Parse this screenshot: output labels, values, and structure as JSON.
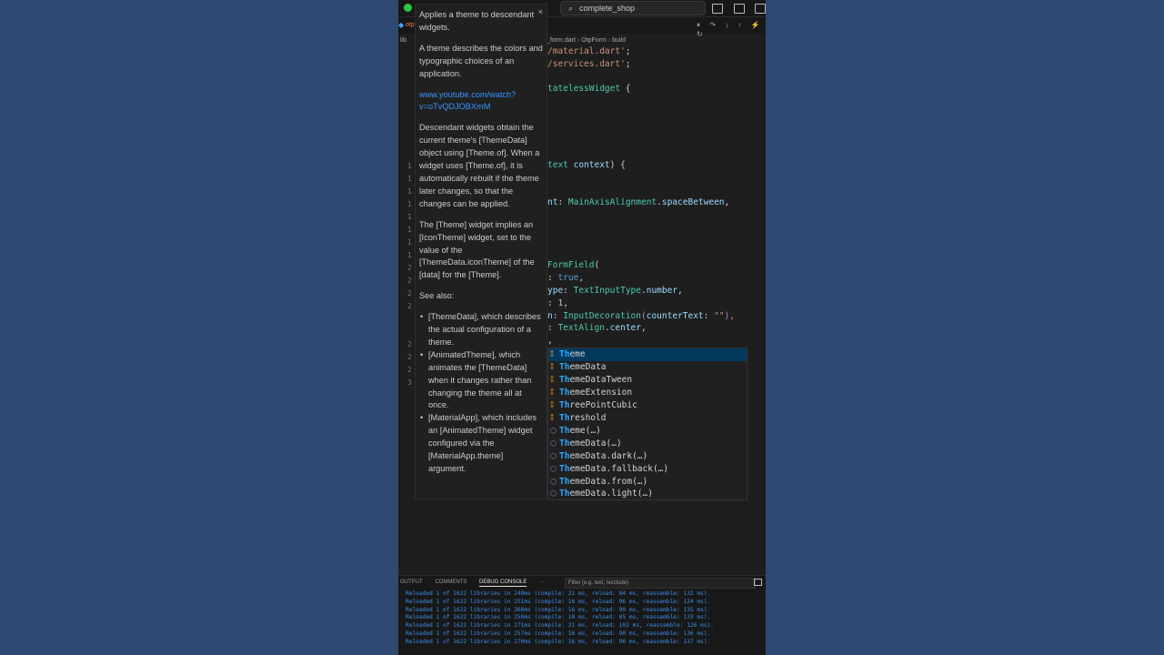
{
  "titlebar": {
    "search_text": "complete_shop"
  },
  "tabs": {
    "active_tab_label": "otp"
  },
  "breadcrumb": {
    "root": "lib",
    "file": "_form.dart",
    "class_name": "OtpForm",
    "method": "build"
  },
  "gutter": [
    "1",
    "1",
    "1",
    "1",
    "1",
    "1",
    "1",
    "1",
    "2",
    "2",
    "2",
    "2",
    "2",
    "2",
    "2",
    "3"
  ],
  "code": {
    "l1_str": "/material.dart'",
    "l1_end": ";",
    "l2_str": "/services.dart'",
    "l2_end": ";",
    "l3_a": "tatelessWidget",
    "l3_b": " {",
    "l4_a": "text",
    "l4_b": " context",
    "l4_c": ") {",
    "l5_a": "nt",
    "l5_b": ": ",
    "l5_c": "MainAxisAlignment",
    "l5_d": ".",
    "l5_e": "spaceBetween",
    "l5_f": ",",
    "l6_a": "FormField",
    "l6_b": "(",
    "l7_a": ": ",
    "l7_b": "true",
    "l7_c": ",",
    "l8_a": "ype",
    "l8_b": ": ",
    "l8_c": "TextInputType",
    "l8_d": ".",
    "l8_e": "number",
    "l8_f": ",",
    "l9_a": ": ",
    "l9_b": "1",
    "l9_c": ",",
    "l10_a": "n",
    "l10_b": ": ",
    "l10_c": "InputDecoration",
    "l10_d": "(",
    "l10_e": "counterText",
    "l10_f": ": ",
    "l10_g": "\"\"",
    "l10_h": "),",
    "l11_a": ": ",
    "l11_b": "TextAlign",
    "l11_c": ".",
    "l11_d": "center",
    "l11_e": ",",
    "l12_a": ","
  },
  "hover": {
    "p1": "Applies a theme to descendant widgets.",
    "p2": "A theme describes the colors and typographic choices of an application.",
    "link": "www.youtube.com/watch?v=oTvQDJOBXmM",
    "p3": "Descendant widgets obtain the current theme's [ThemeData] object using [Theme.of]. When a widget uses [Theme.of], it is automatically rebuilt if the theme later changes, so that the changes can be applied.",
    "p4": "The [Theme] widget implies an [IconTheme] widget, set to the value of the [ThemeData.iconTheme] of the [data] for the [Theme].",
    "see_also": "See also:",
    "bullets": [
      "[ThemeData], which describes the actual configuration of a theme.",
      "[AnimatedTheme], which animates the [ThemeData] when it changes rather than changing the theme all at once.",
      "[MaterialApp], which includes an [AnimatedTheme] widget configured via the [MaterialApp.theme] argument."
    ],
    "close": "×"
  },
  "suggestions": [
    {
      "match": "Th",
      "rest": "eme",
      "kind": "class"
    },
    {
      "match": "Th",
      "rest": "emeData",
      "kind": "class"
    },
    {
      "match": "Th",
      "rest": "emeDataTween",
      "kind": "class"
    },
    {
      "match": "Th",
      "rest": "emeExtension",
      "kind": "class"
    },
    {
      "match": "Th",
      "rest": "reePointCubic",
      "kind": "class"
    },
    {
      "match": "Th",
      "rest": "reshold",
      "kind": "class"
    },
    {
      "match": "Th",
      "rest": "eme(…)",
      "kind": "method"
    },
    {
      "match": "Th",
      "rest": "emeData(…)",
      "kind": "method"
    },
    {
      "match": "Th",
      "rest": "emeData.dark(…)",
      "kind": "method"
    },
    {
      "match": "Th",
      "rest": "emeData.fallback(…)",
      "kind": "method"
    },
    {
      "match": "Th",
      "rest": "emeData.from(…)",
      "kind": "method"
    },
    {
      "match": "Th",
      "rest": "emeData.light(…)",
      "kind": "method"
    }
  ],
  "panel": {
    "tab_output": "OUTPUT",
    "tab_comments": "COMMENTS",
    "tab_debug": "DEBUG CONSOLE",
    "more": "···",
    "filter_placeholder": "Filter (e.g. text, !exclude)",
    "log_lines": [
      "Reloaded 1 of 1622 libraries in 249ms (compile: 21 ms, reload: 84 ms, reassemble: 132 ms).",
      "Reloaded 1 of 1622 libraries in 251ms (compile: 16 ms, reload: 96 ms, reassemble: 124 ms).",
      "Reloaded 1 of 1622 libraries in 260ms (compile: 16 ms, reload: 90 ms, reassemble: 135 ms).",
      "Reloaded 1 of 1622 libraries in 250ms (compile: 18 ms, reload: 85 ms, reassemble: 133 ms).",
      "Reloaded 1 of 1622 libraries in 271ms (compile: 21 ms, reload: 102 ms, reassemble: 126 ms).",
      "Reloaded 1 of 1622 libraries in 257ms (compile: 16 ms, reload: 90 ms, reassemble: 136 ms).",
      "Reloaded 1 of 1622 libraries in 270ms (compile: 16 ms, reload: 96 ms, reassemble: 137 ms)."
    ]
  },
  "colors": {
    "background": "#2f4a72",
    "editor": "#1e1e1e",
    "selection": "#04395e",
    "match": "#2aaaff"
  }
}
